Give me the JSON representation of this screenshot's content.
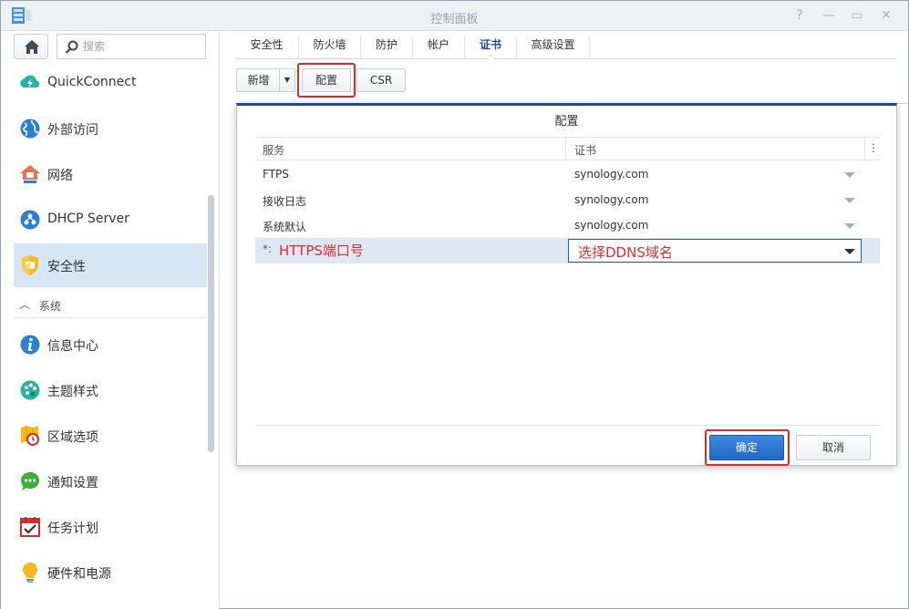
{
  "window": {
    "title": "控制面板"
  },
  "sidebar": {
    "search_placeholder": "搜索",
    "items": [
      {
        "label": "QuickConnect",
        "icon": "quickconnect-icon"
      },
      {
        "label": "外部访问",
        "icon": "globe-icon"
      },
      {
        "label": "网络",
        "icon": "network-house-icon"
      },
      {
        "label": "DHCP Server",
        "icon": "dhcp-icon"
      },
      {
        "label": "安全性",
        "icon": "shield-icon",
        "active": true
      }
    ],
    "section": {
      "label": "系统"
    },
    "system_items": [
      {
        "label": "信息中心",
        "icon": "info-icon"
      },
      {
        "label": "主题样式",
        "icon": "palette-icon"
      },
      {
        "label": "区域选项",
        "icon": "map-clock-icon"
      },
      {
        "label": "通知设置",
        "icon": "chat-bubble-icon"
      },
      {
        "label": "任务计划",
        "icon": "calendar-check-icon"
      },
      {
        "label": "硬件和电源",
        "icon": "lightbulb-icon"
      }
    ]
  },
  "tabs": [
    {
      "label": "安全性"
    },
    {
      "label": "防火墙"
    },
    {
      "label": "防护"
    },
    {
      "label": "帐户"
    },
    {
      "label": "证书",
      "active": true
    },
    {
      "label": "高级设置"
    }
  ],
  "toolbar": {
    "new_label": "新增",
    "config_label": "配置",
    "csr_label": "CSR"
  },
  "dialog": {
    "title": "配置",
    "col_service": "服务",
    "col_cert": "证书",
    "more": "⋮",
    "rows": [
      {
        "service": "FTPS",
        "cert": "synology.com"
      },
      {
        "service": "接收日志",
        "cert": "synology.com"
      },
      {
        "service": "系统默认",
        "cert": "synology.com"
      }
    ],
    "selected_row": {
      "service_prefix": "*:",
      "service_annotation": "HTTPS端口号",
      "cert_annotation": "选择DDNS域名"
    },
    "ok_label": "确定",
    "cancel_label": "取消"
  },
  "colors": {
    "accent": "#2068c4",
    "annotation_red": "#e02c2c",
    "active_nav": "#d7e6f5"
  }
}
